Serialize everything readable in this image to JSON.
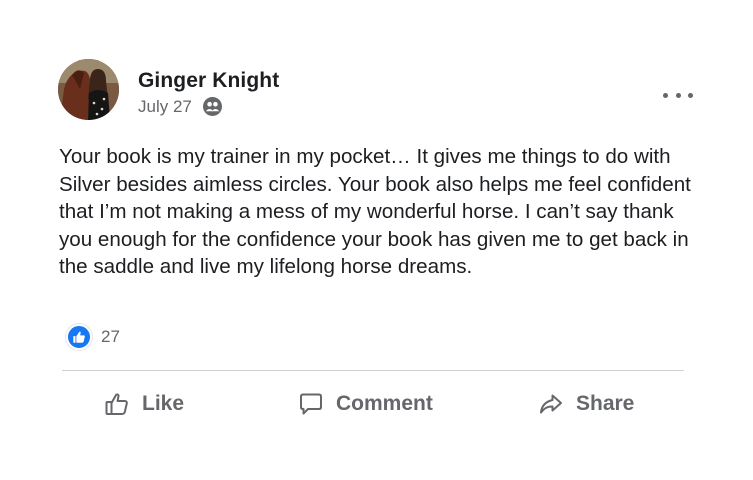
{
  "post": {
    "author": "Ginger Knight",
    "date": "July 27",
    "privacy_icon": "friends-icon",
    "text": "Your book is my trainer in my pocket… It gives me things to do with Silver besides aimless circles. Your book also helps me feel confident that I’m not making a mess of my wonderful horse. I can’t say thank you enough for the confidence your book has given me to get back in the saddle and live my lifelong horse dreams.",
    "reaction_count": "27",
    "reaction_icon": "like-reaction-icon"
  },
  "actions": {
    "like_label": "Like",
    "comment_label": "Comment",
    "share_label": "Share"
  },
  "colors": {
    "text_primary": "#1c1e21",
    "text_secondary": "#65676b",
    "like_blue": "#1877f2",
    "divider": "#ced0d4"
  }
}
